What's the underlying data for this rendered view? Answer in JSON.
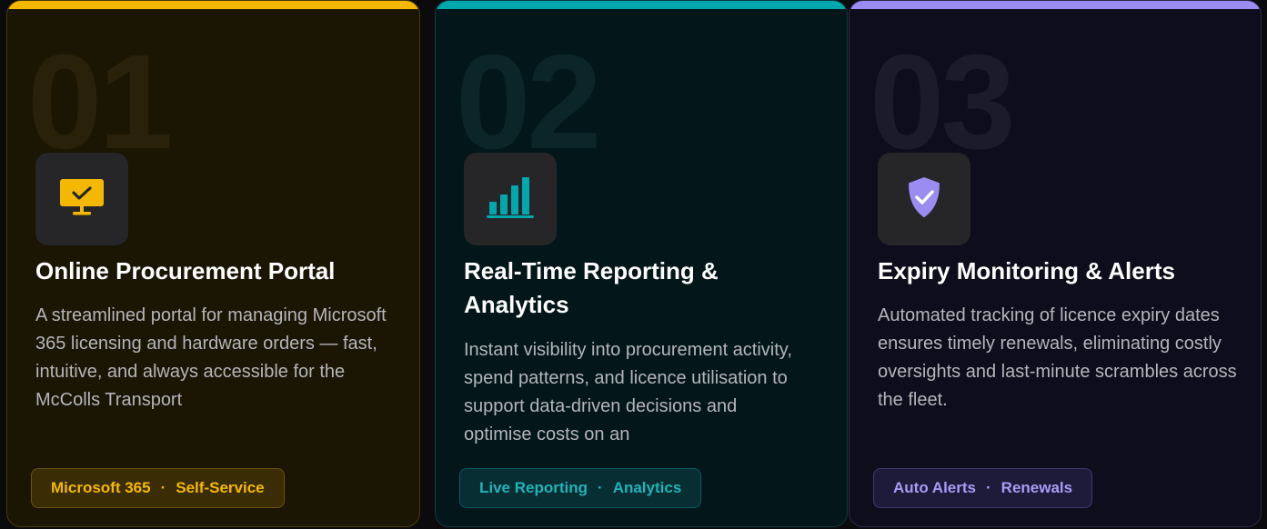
{
  "cards": [
    {
      "number": "01",
      "icon": "monitor-check-icon",
      "accent": "#f5b800",
      "title": "Online Procurement Portal",
      "description": "A streamlined portal for managing Microsoft 365 licensing and hardware orders — fast, intuitive, and always accessible for the McColls Transport",
      "tags": [
        "Microsoft 365",
        "Self-Service"
      ],
      "separator": "·"
    },
    {
      "number": "02",
      "icon": "bar-chart-icon",
      "accent": "#00a8ad",
      "title": "Real-Time Reporting & Analytics",
      "description": "Instant visibility into procurement activity, spend patterns, and licence utilisation to support data-driven decisions and optimise costs on an",
      "tags": [
        "Live Reporting",
        "Analytics"
      ],
      "separator": "·"
    },
    {
      "number": "03",
      "icon": "shield-check-icon",
      "accent": "#9a8cf0",
      "title": "Expiry Monitoring & Alerts",
      "description": "Automated tracking of licence expiry dates ensures timely renewals, eliminating costly oversights and last-minute scrambles across the fleet.",
      "tags": [
        "Auto Alerts",
        "Renewals"
      ],
      "separator": "·"
    }
  ]
}
